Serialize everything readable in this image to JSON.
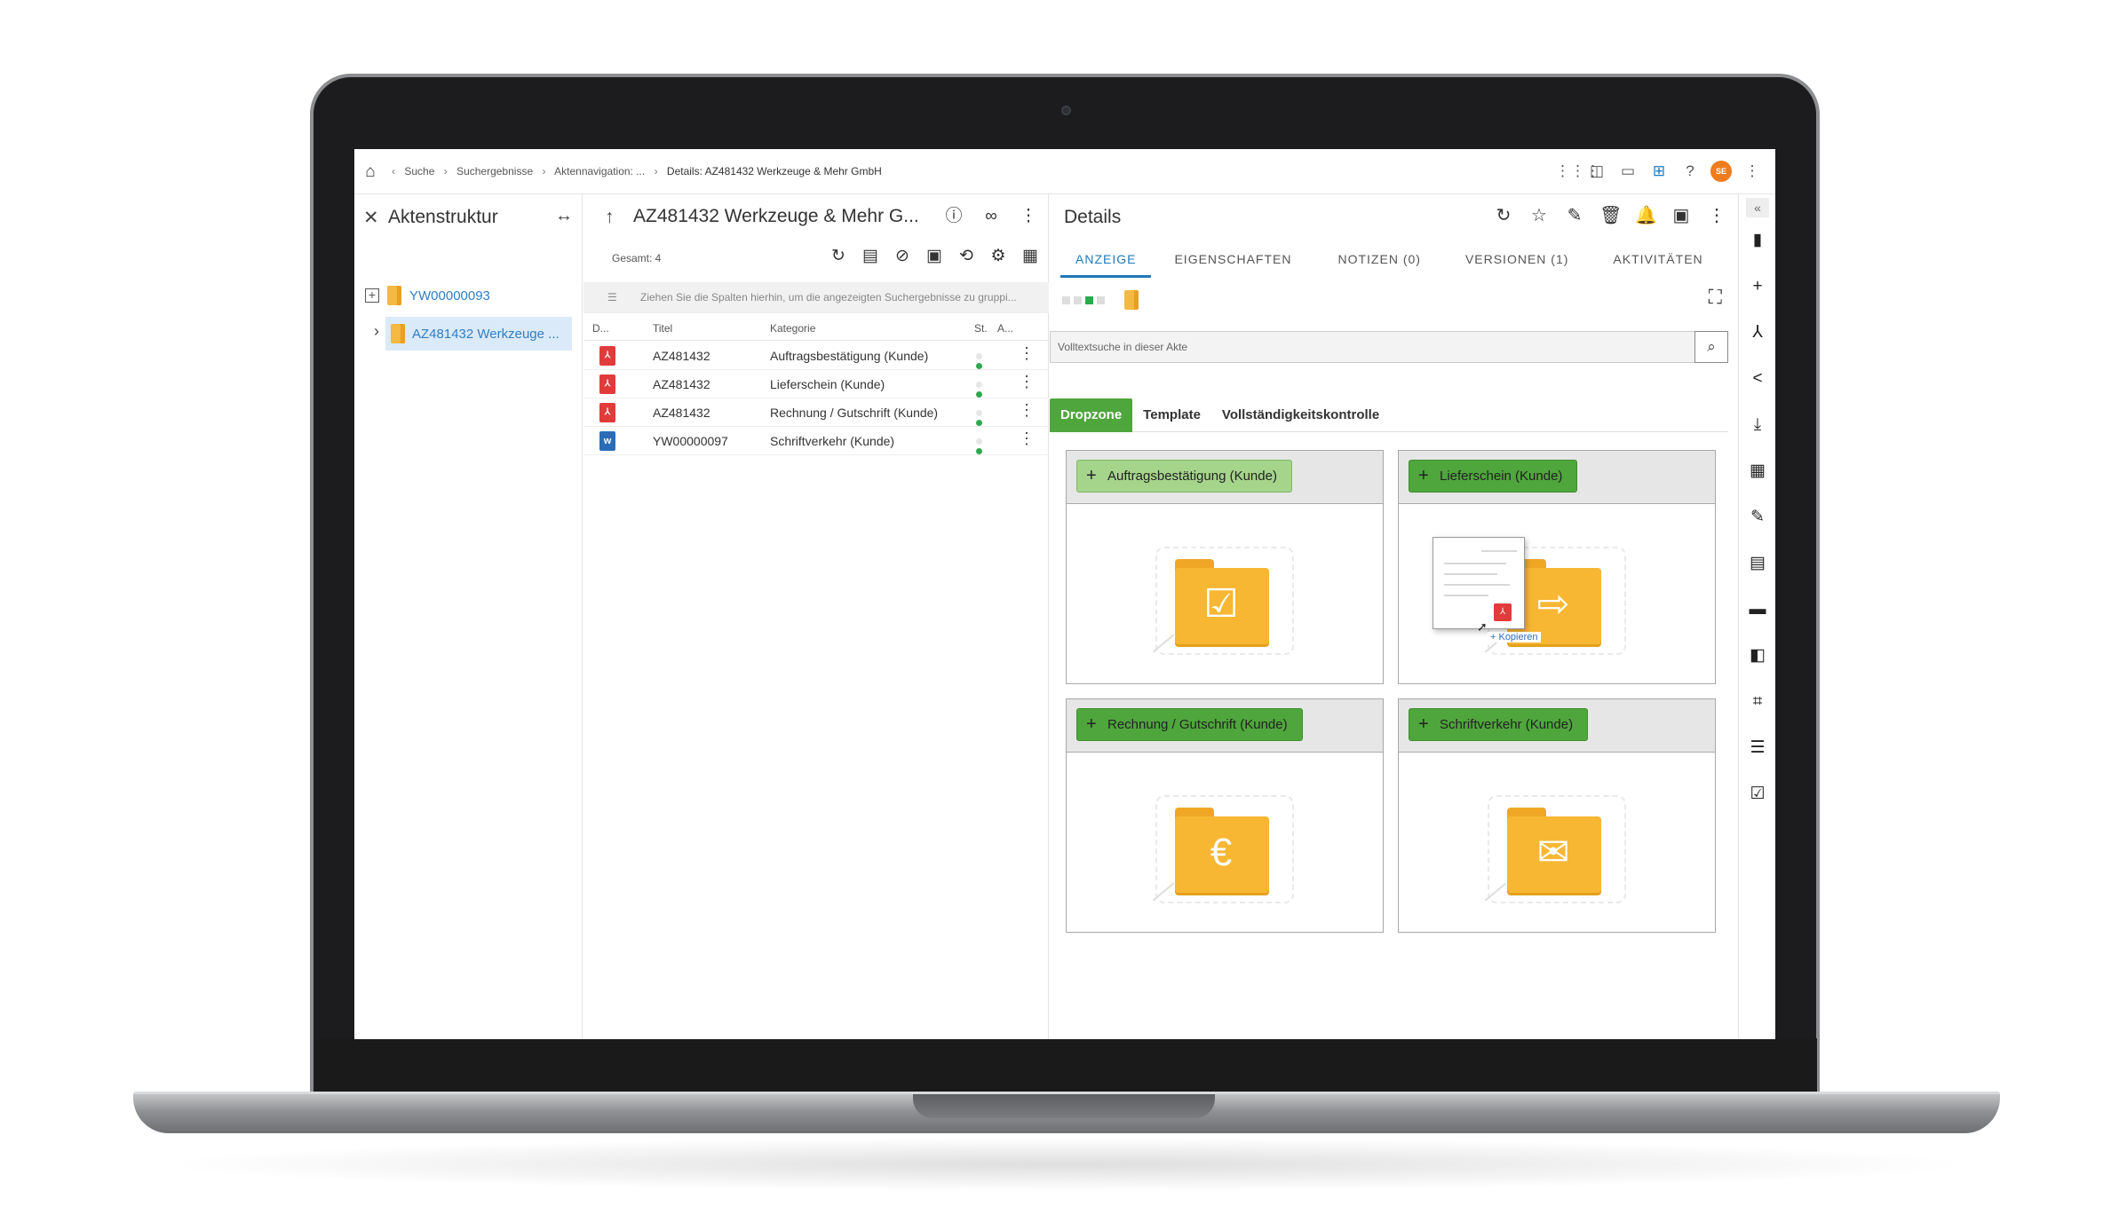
{
  "breadcrumbs": {
    "items": [
      "Suche",
      "Suchergebnisse",
      "Aktennavigation: ...",
      "Details: AZ481432 Werkzeuge & Mehr GmbH"
    ]
  },
  "avatar": {
    "initials": "SE"
  },
  "left_panel": {
    "title": "Aktenstruktur",
    "tree": [
      {
        "label": "YW00000093"
      },
      {
        "label": "AZ481432 Werkzeuge ..."
      }
    ]
  },
  "middle_panel": {
    "title": "AZ481432 Werkzeuge & Mehr G...",
    "total": "Gesamt: 4",
    "group_hint": "Ziehen Sie die Spalten hierhin, um die angezeigten Suchergebnisse zu gruppi...",
    "columns": {
      "type": "D...",
      "title": "Titel",
      "category": "Kategorie",
      "status": "St.",
      "actions": "A..."
    },
    "rows": [
      {
        "file_type": "pdf",
        "title": "AZ481432",
        "category": "Auftragsbestätigung (Kunde)"
      },
      {
        "file_type": "pdf",
        "title": "AZ481432",
        "category": "Lieferschein (Kunde)"
      },
      {
        "file_type": "pdf",
        "title": "AZ481432",
        "category": "Rechnung / Gutschrift (Kunde)"
      },
      {
        "file_type": "word",
        "title": "YW00000097",
        "category": "Schriftverkehr (Kunde)"
      }
    ]
  },
  "details_panel": {
    "title": "Details",
    "tabs": [
      "ANZEIGE",
      "EIGENSCHAFTEN",
      "NOTIZEN (0)",
      "VERSIONEN (1)",
      "AKTIVITÄTEN"
    ],
    "active_tab": "ANZEIGE",
    "search_placeholder": "Volltextsuche in dieser Akte",
    "subtabs": [
      "Dropzone",
      "Template",
      "Vollständigkeitskontrolle"
    ],
    "active_subtab": "Dropzone",
    "dropzones": [
      {
        "label": "Auftragsbestätigung (Kunde)",
        "highlighted": true,
        "icon": "folder-checklist-icon"
      },
      {
        "label": "Lieferschein (Kunde)",
        "highlighted": false,
        "icon": "folder-document-arrow-icon"
      },
      {
        "label": "Rechnung / Gutschrift (Kunde)",
        "highlighted": false,
        "icon": "folder-euro-icon"
      },
      {
        "label": "Schriftverkehr (Kunde)",
        "highlighted": false,
        "icon": "folder-letter-icon"
      }
    ],
    "drag_hint": "+ Kopieren"
  },
  "colors": {
    "accent_blue": "#1f7ab8",
    "dropzone_green": "#4fa63c",
    "dropzone_green_light": "#a5d48b",
    "folder_yellow": "#f7b733",
    "pdf_red": "#e13b3b",
    "word_blue": "#2b6cb8"
  }
}
